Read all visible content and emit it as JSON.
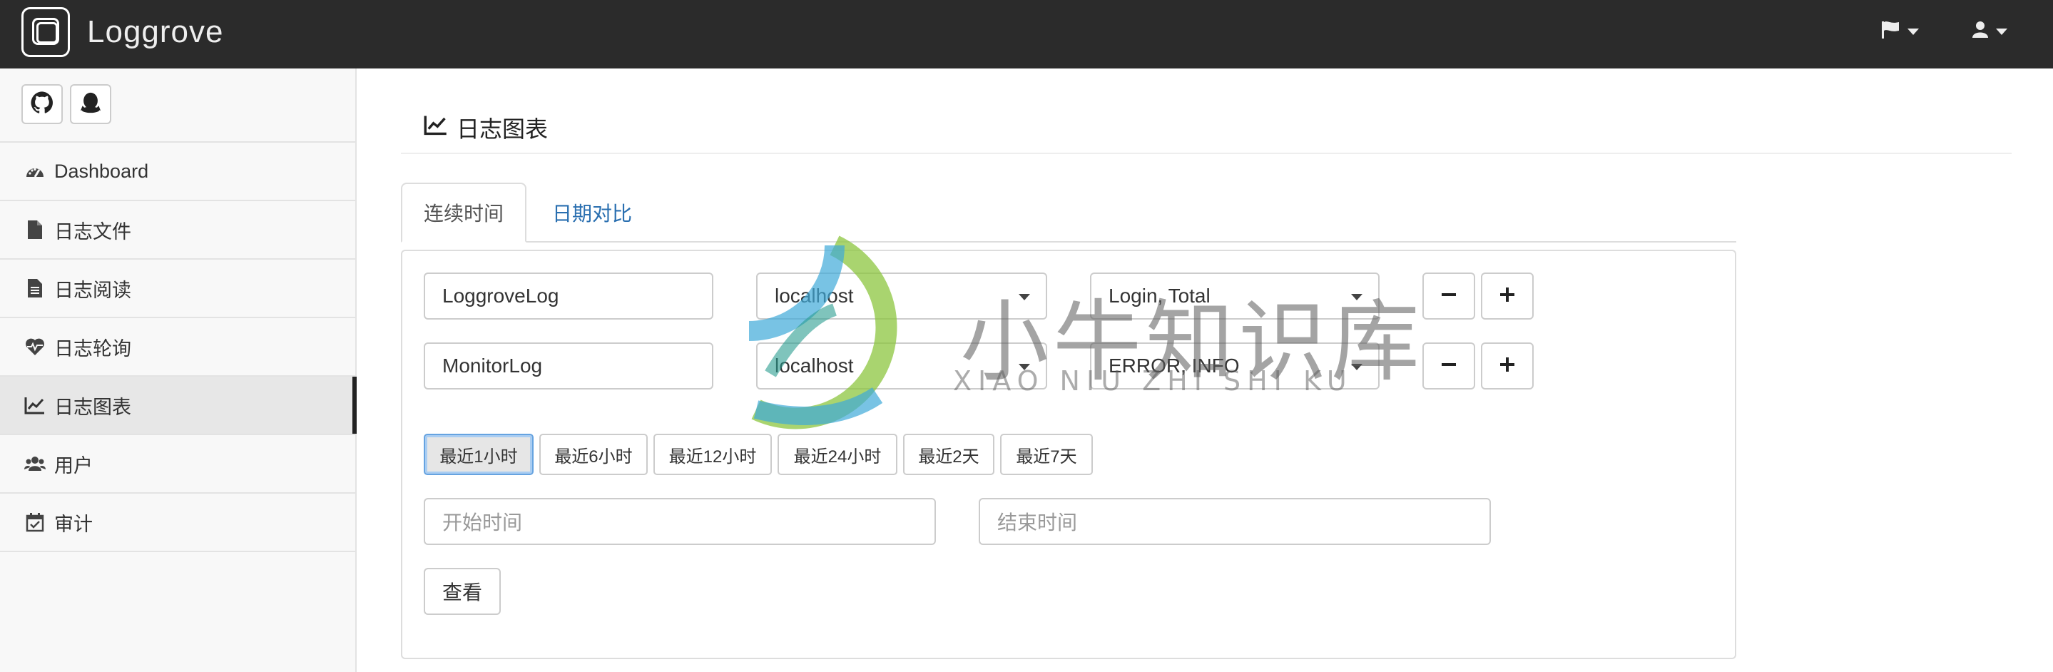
{
  "app": {
    "brand": "Loggrove"
  },
  "sidebar": {
    "items": [
      {
        "label": "Dashboard",
        "icon": "dashboard-icon"
      },
      {
        "label": "日志文件",
        "icon": "file-icon"
      },
      {
        "label": "日志阅读",
        "icon": "file-text-icon"
      },
      {
        "label": "日志轮询",
        "icon": "heartbeat-icon"
      },
      {
        "label": "日志图表",
        "icon": "line-chart-icon",
        "active": true
      },
      {
        "label": "用户",
        "icon": "users-icon"
      },
      {
        "label": "审计",
        "icon": "calendar-check-icon"
      }
    ]
  },
  "page": {
    "title": "日志图表"
  },
  "tabs": [
    {
      "label": "连续时间",
      "active": true
    },
    {
      "label": "日期对比",
      "active": false
    }
  ],
  "rows": [
    {
      "log": "LoggroveLog",
      "host": "localhost",
      "keywords": "Login, Total"
    },
    {
      "log": "MonitorLog",
      "host": "localhost",
      "keywords": "ERROR, INFO"
    }
  ],
  "ranges": [
    "最近1小时",
    "最近6小时",
    "最近12小时",
    "最近24小时",
    "最近2天",
    "最近7天"
  ],
  "inputs": {
    "start_placeholder": "开始时间",
    "end_placeholder": "结束时间"
  },
  "actions": {
    "view_label": "查看"
  },
  "watermark": {
    "text": "小牛知识库",
    "sub": "XIAO NIU ZHI SHI KU"
  },
  "colors": {
    "navbar": "#2b2b2b",
    "link": "#2a6fb0",
    "active_focus": "#66a3e0"
  }
}
